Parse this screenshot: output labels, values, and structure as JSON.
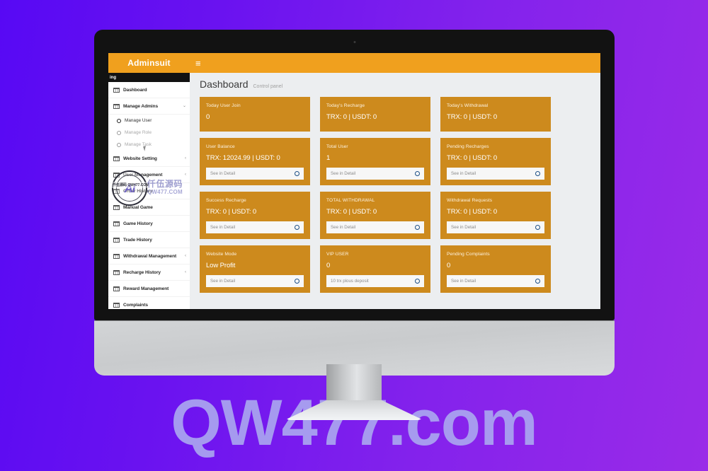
{
  "watermarks": {
    "bottom_text": "QW477.com",
    "stamp_logo": "Ai",
    "stamp_cn": "仟伍源码",
    "stamp_url": "QW477.COM",
    "stamp_badge": "仟伍源码 QW477.COM"
  },
  "header": {
    "brand": "Adminsuit",
    "hamburger": "≡"
  },
  "sidebar": {
    "topbar_text": "ing",
    "items": [
      {
        "label": "Dashboard",
        "caret": ""
      },
      {
        "label": "Manage Admins",
        "caret": "⌄"
      },
      {
        "label": "Website Setting",
        "caret": "‹"
      },
      {
        "label": "User Management",
        "caret": "‹"
      },
      {
        "label": "Order History",
        "caret": ""
      },
      {
        "label": "Manual Game",
        "caret": ""
      },
      {
        "label": "Game History",
        "caret": ""
      },
      {
        "label": "Trade History",
        "caret": ""
      },
      {
        "label": "Withdrawal Management",
        "caret": "‹"
      },
      {
        "label": "Recharge History",
        "caret": "‹"
      },
      {
        "label": "Reward Management",
        "caret": ""
      },
      {
        "label": "Complaints",
        "caret": ""
      }
    ],
    "submenu": [
      {
        "label": "Manage User",
        "active": true
      },
      {
        "label": "Manage Role",
        "active": false
      },
      {
        "label": "Manage Task",
        "active": false
      }
    ]
  },
  "main": {
    "page_title": "Dashboard",
    "page_subtitle": "Control panel",
    "cards": [
      {
        "title": "Today User Join",
        "value": "0",
        "action": null
      },
      {
        "title": "Today's Recharge",
        "value": "TRX: 0 | USDT: 0",
        "action": null
      },
      {
        "title": "Today's Withdrawal",
        "value": "TRX: 0 | USDT: 0",
        "action": null
      },
      {
        "title": "User Balance",
        "value": "TRX: 12024.99 | USDT: 0",
        "action": "See in Detail"
      },
      {
        "title": "Total User",
        "value": "1",
        "action": "See in Detail"
      },
      {
        "title": "Pending Recharges",
        "value": "TRX: 0 | USDT: 0",
        "action": "See in Detail"
      },
      {
        "title": "Success Recharge",
        "value": "TRX: 0 | USDT: 0",
        "action": "See in Detail"
      },
      {
        "title": "TOTAL WITHDRAWAL",
        "value": "TRX: 0 | USDT: 0",
        "action": "See in Detail"
      },
      {
        "title": "Withdrawal Requests",
        "value": "TRX: 0 | USDT: 0",
        "action": "See in Detail"
      },
      {
        "title": "Website Mode",
        "value": "Low Profit",
        "action": "See in Detail"
      },
      {
        "title": "VIP USER",
        "value": "0",
        "action": "10 trx plous deposit"
      },
      {
        "title": "Pending Complaints",
        "value": "0",
        "action": "See in Detail"
      }
    ]
  },
  "colors": {
    "header_orange": "#f0a01e",
    "card_orange": "#cd8a1d",
    "bg_violet_left": "#5709f4",
    "bg_violet_right": "#9a2be8",
    "watermark_periwinkle": "#aaa6f0",
    "action_icon_blue": "#1c4f86"
  }
}
